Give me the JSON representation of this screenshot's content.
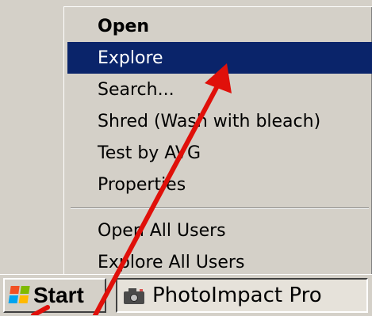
{
  "context_menu": {
    "items": [
      {
        "label": "Open"
      },
      {
        "label": "Explore"
      },
      {
        "label": "Search..."
      },
      {
        "label": "Shred (Wash with bleach)"
      },
      {
        "label": "Test by AVG"
      },
      {
        "label": "Properties"
      }
    ],
    "all_users_items": [
      {
        "label": "Open All Users"
      },
      {
        "label": "Explore All Users"
      }
    ]
  },
  "taskbar": {
    "start_label": "Start",
    "task_button_label": "PhotoImpact Pro",
    "task_button_icon": "camera-icon"
  },
  "colors": {
    "menu_highlight": "#0a246a",
    "annotation_arrow": "#e0100a"
  }
}
